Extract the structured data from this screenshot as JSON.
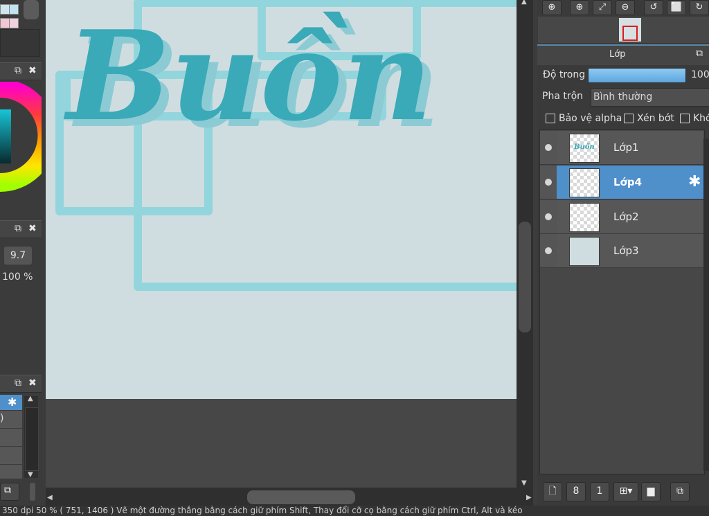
{
  "left_panel": {
    "brush_size": "9.7",
    "brush_opacity": "100 %",
    "popout_icon": "popout-icon",
    "close_icon": "close-icon",
    "list_value": ")"
  },
  "canvas": {
    "lettering": "Buồn",
    "bg_color": "#d0dde0",
    "lettering_color": "#3aa9b8",
    "frame_color": "#93d5dc"
  },
  "layer_panel": {
    "title": "Lớp",
    "opacity_label": "Độ trong",
    "opacity_value": "100",
    "opacity_percent": 100,
    "blend_label": "Pha trộn",
    "blend_value": "Bình thường",
    "protect_alpha_label": "Bảo vệ alpha",
    "clipping_label": "Xén bớt",
    "lock_label": "Khó",
    "layers": [
      {
        "name": "Lớp1",
        "selected": false
      },
      {
        "name": "Lớp4",
        "selected": true
      },
      {
        "name": "Lớp2",
        "selected": false
      },
      {
        "name": "Lớp3",
        "selected": false
      }
    ],
    "accent_color": "#4f8fca"
  },
  "status_bar": {
    "text": "350 dpi  50 %  ( 751, 1406 )  Vẽ một đường thẳng bằng cách giữ phím Shift, Thay đổi cỡ cọ bằng cách giữ phím Ctrl, Alt và kéo"
  }
}
